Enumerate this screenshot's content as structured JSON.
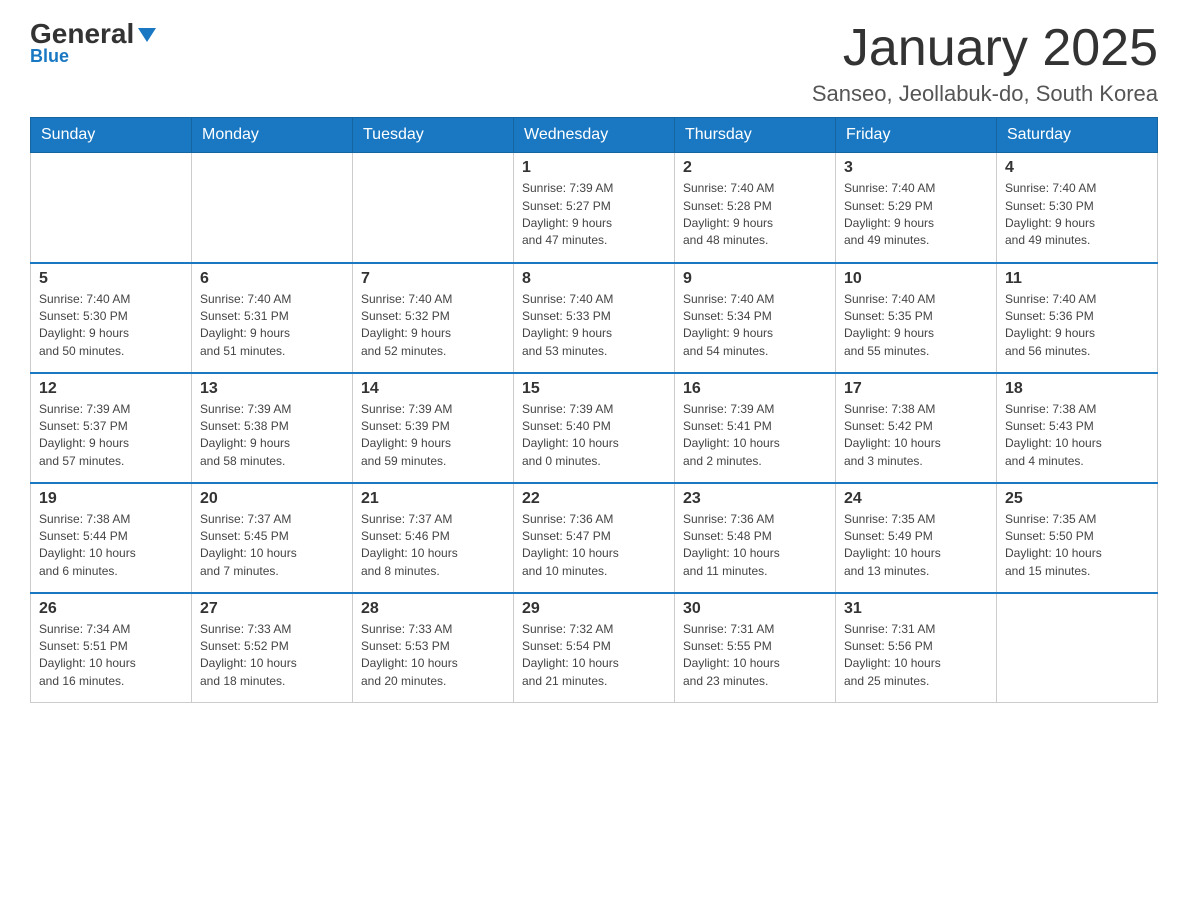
{
  "header": {
    "logo_text": "General",
    "logo_blue": "Blue",
    "month_title": "January 2025",
    "location": "Sanseo, Jeollabuk-do, South Korea"
  },
  "weekdays": [
    "Sunday",
    "Monday",
    "Tuesday",
    "Wednesday",
    "Thursday",
    "Friday",
    "Saturday"
  ],
  "weeks": [
    [
      {
        "day": "",
        "info": ""
      },
      {
        "day": "",
        "info": ""
      },
      {
        "day": "",
        "info": ""
      },
      {
        "day": "1",
        "info": "Sunrise: 7:39 AM\nSunset: 5:27 PM\nDaylight: 9 hours\nand 47 minutes."
      },
      {
        "day": "2",
        "info": "Sunrise: 7:40 AM\nSunset: 5:28 PM\nDaylight: 9 hours\nand 48 minutes."
      },
      {
        "day": "3",
        "info": "Sunrise: 7:40 AM\nSunset: 5:29 PM\nDaylight: 9 hours\nand 49 minutes."
      },
      {
        "day": "4",
        "info": "Sunrise: 7:40 AM\nSunset: 5:30 PM\nDaylight: 9 hours\nand 49 minutes."
      }
    ],
    [
      {
        "day": "5",
        "info": "Sunrise: 7:40 AM\nSunset: 5:30 PM\nDaylight: 9 hours\nand 50 minutes."
      },
      {
        "day": "6",
        "info": "Sunrise: 7:40 AM\nSunset: 5:31 PM\nDaylight: 9 hours\nand 51 minutes."
      },
      {
        "day": "7",
        "info": "Sunrise: 7:40 AM\nSunset: 5:32 PM\nDaylight: 9 hours\nand 52 minutes."
      },
      {
        "day": "8",
        "info": "Sunrise: 7:40 AM\nSunset: 5:33 PM\nDaylight: 9 hours\nand 53 minutes."
      },
      {
        "day": "9",
        "info": "Sunrise: 7:40 AM\nSunset: 5:34 PM\nDaylight: 9 hours\nand 54 minutes."
      },
      {
        "day": "10",
        "info": "Sunrise: 7:40 AM\nSunset: 5:35 PM\nDaylight: 9 hours\nand 55 minutes."
      },
      {
        "day": "11",
        "info": "Sunrise: 7:40 AM\nSunset: 5:36 PM\nDaylight: 9 hours\nand 56 minutes."
      }
    ],
    [
      {
        "day": "12",
        "info": "Sunrise: 7:39 AM\nSunset: 5:37 PM\nDaylight: 9 hours\nand 57 minutes."
      },
      {
        "day": "13",
        "info": "Sunrise: 7:39 AM\nSunset: 5:38 PM\nDaylight: 9 hours\nand 58 minutes."
      },
      {
        "day": "14",
        "info": "Sunrise: 7:39 AM\nSunset: 5:39 PM\nDaylight: 9 hours\nand 59 minutes."
      },
      {
        "day": "15",
        "info": "Sunrise: 7:39 AM\nSunset: 5:40 PM\nDaylight: 10 hours\nand 0 minutes."
      },
      {
        "day": "16",
        "info": "Sunrise: 7:39 AM\nSunset: 5:41 PM\nDaylight: 10 hours\nand 2 minutes."
      },
      {
        "day": "17",
        "info": "Sunrise: 7:38 AM\nSunset: 5:42 PM\nDaylight: 10 hours\nand 3 minutes."
      },
      {
        "day": "18",
        "info": "Sunrise: 7:38 AM\nSunset: 5:43 PM\nDaylight: 10 hours\nand 4 minutes."
      }
    ],
    [
      {
        "day": "19",
        "info": "Sunrise: 7:38 AM\nSunset: 5:44 PM\nDaylight: 10 hours\nand 6 minutes."
      },
      {
        "day": "20",
        "info": "Sunrise: 7:37 AM\nSunset: 5:45 PM\nDaylight: 10 hours\nand 7 minutes."
      },
      {
        "day": "21",
        "info": "Sunrise: 7:37 AM\nSunset: 5:46 PM\nDaylight: 10 hours\nand 8 minutes."
      },
      {
        "day": "22",
        "info": "Sunrise: 7:36 AM\nSunset: 5:47 PM\nDaylight: 10 hours\nand 10 minutes."
      },
      {
        "day": "23",
        "info": "Sunrise: 7:36 AM\nSunset: 5:48 PM\nDaylight: 10 hours\nand 11 minutes."
      },
      {
        "day": "24",
        "info": "Sunrise: 7:35 AM\nSunset: 5:49 PM\nDaylight: 10 hours\nand 13 minutes."
      },
      {
        "day": "25",
        "info": "Sunrise: 7:35 AM\nSunset: 5:50 PM\nDaylight: 10 hours\nand 15 minutes."
      }
    ],
    [
      {
        "day": "26",
        "info": "Sunrise: 7:34 AM\nSunset: 5:51 PM\nDaylight: 10 hours\nand 16 minutes."
      },
      {
        "day": "27",
        "info": "Sunrise: 7:33 AM\nSunset: 5:52 PM\nDaylight: 10 hours\nand 18 minutes."
      },
      {
        "day": "28",
        "info": "Sunrise: 7:33 AM\nSunset: 5:53 PM\nDaylight: 10 hours\nand 20 minutes."
      },
      {
        "day": "29",
        "info": "Sunrise: 7:32 AM\nSunset: 5:54 PM\nDaylight: 10 hours\nand 21 minutes."
      },
      {
        "day": "30",
        "info": "Sunrise: 7:31 AM\nSunset: 5:55 PM\nDaylight: 10 hours\nand 23 minutes."
      },
      {
        "day": "31",
        "info": "Sunrise: 7:31 AM\nSunset: 5:56 PM\nDaylight: 10 hours\nand 25 minutes."
      },
      {
        "day": "",
        "info": ""
      }
    ]
  ]
}
